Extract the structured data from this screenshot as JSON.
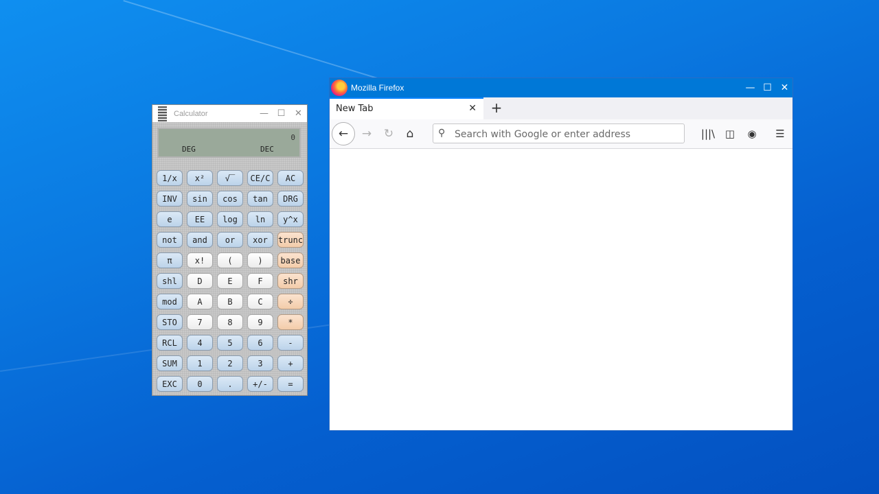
{
  "calculator": {
    "title": "Calculator",
    "display": {
      "value": "0",
      "angle_mode": "DEG",
      "base_mode": "DEC"
    },
    "keys": [
      [
        "1/x",
        "x²",
        "√‾",
        "CE/C",
        "AC"
      ],
      [
        "INV",
        "sin",
        "cos",
        "tan",
        "DRG"
      ],
      [
        "e",
        "EE",
        "log",
        "ln",
        "y^x"
      ],
      [
        "not",
        "and",
        "or",
        "xor",
        "trunc"
      ],
      [
        "π",
        "x!",
        "(",
        ")",
        "base"
      ],
      [
        "shl",
        "D",
        "E",
        "F",
        "shr"
      ],
      [
        "mod",
        "A",
        "B",
        "C",
        "÷"
      ],
      [
        "STO",
        "7",
        "8",
        "9",
        "*"
      ],
      [
        "RCL",
        "4",
        "5",
        "6",
        "-"
      ],
      [
        "SUM",
        "1",
        "2",
        "3",
        "+"
      ],
      [
        "EXC",
        "0",
        ".",
        "+/-",
        "="
      ]
    ]
  },
  "firefox": {
    "title": "Mozilla Firefox",
    "tab_label": "New Tab",
    "tab_close": "✕",
    "new_tab": "+",
    "url_placeholder": "Search with Google or enter address",
    "icons": {
      "back": "←",
      "forward": "→",
      "reload": "↻",
      "home": "⌂",
      "search": "⚲",
      "library": "|||\\",
      "sidebar": "◫",
      "account": "◉",
      "menu": "☰"
    },
    "window_controls": {
      "minimize": "—",
      "maximize": "☐",
      "close": "✕"
    }
  },
  "calc_window_controls": {
    "minimize": "—",
    "maximize": "☐",
    "close": "✕"
  }
}
